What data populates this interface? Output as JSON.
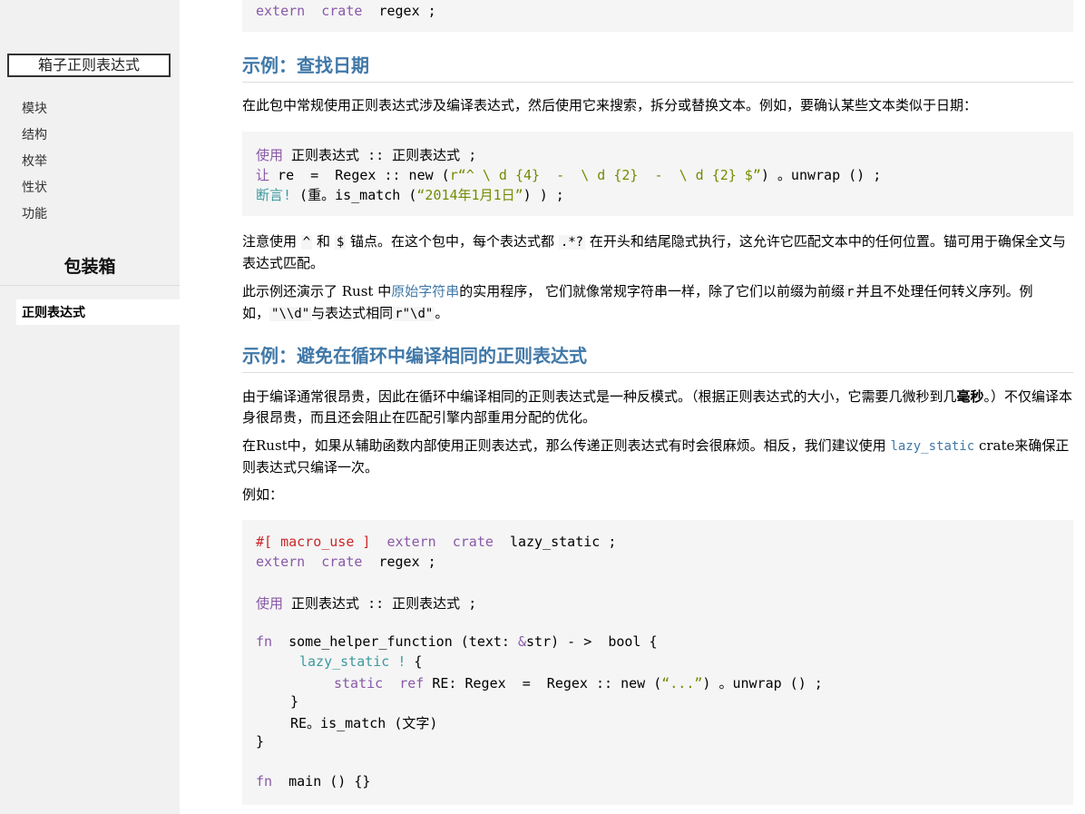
{
  "sidebar": {
    "search_value": "箱子正则表达式",
    "nav_items": [
      "模块",
      "结构",
      "枚举",
      "性状",
      "功能"
    ],
    "crate_title": "包装箱",
    "current_item": "正则表达式"
  },
  "top_code": {
    "line": [
      "extern",
      "crate",
      "regex ;"
    ]
  },
  "section1": {
    "heading": "示例：查找日期",
    "intro": "在此包中常规使用正则表达式涉及编译表达式，然后使用它来搜索，拆分或替换文本。例如，要确认某些文本类似于日期：",
    "code": {
      "l1": [
        "使用",
        " 正则表达式 :: 正则表达式 ;"
      ],
      "l2": [
        "让",
        " re  =  Regex :: new (",
        "r“^ \\ d {4}  -  \\ d {2}  -  \\ d {2} $”",
        ") 。unwrap () ;"
      ],
      "l3": [
        "断言!",
        " (重。is_match (",
        "“2014年1月1日”",
        ") ) ;"
      ]
    },
    "p2": {
      "t1": "注意使用",
      "c1": "^",
      "t2": "和",
      "c2": "$",
      "t3": "锚点。在这个包中，每个表达式都",
      "c3": ".*?",
      "t4": "在开头和结尾隐式执行，这允许它匹配文本中的任何位置。锚可用于确保全文与表达式匹配。"
    },
    "p3": {
      "t1": "此示例还演示了 Rust 中",
      "link": "原始字符串",
      "t2": "的实用程序， 它们就像常规字符串一样，除了它们以前缀为前缀",
      "c1": "r",
      "t3": "并且不处理任何转义序列。例如，",
      "c2": "\"\\\\d\"",
      "t4": "与表达式相同",
      "c3": "r\"\\d\"",
      "t5": "。"
    }
  },
  "section2": {
    "heading": "示例：避免在循环中编译相同的正则表达式",
    "p1": {
      "t1": "由于编译通常很昂贵，因此在循环中编译相同的正则表达式是一种反模式。（根据正则表达式的大小，它需要几微秒到几",
      "bold": "毫秒",
      "t2": "。）不仅编译本身很昂贵，而且还会阻止在匹配引擎内部重用分配的优化。"
    },
    "p2": {
      "t1": "在Rust中，如果从辅助函数内部使用正则表达式，那么传递正则表达式有时会很麻烦。相反，我们建议使用 ",
      "link": "lazy_static",
      "t2": " crate来确保正则表达式只编译一次。"
    },
    "p3": "例如：",
    "code": {
      "l1": [
        "#[ macro_use ]",
        "extern",
        "crate",
        "lazy_static ;"
      ],
      "l2": [
        "extern",
        "crate",
        "regex ;"
      ],
      "l3": [
        "使用",
        " 正则表达式 :: 正则表达式 ;"
      ],
      "l4": [
        "fn",
        "  some_helper_function (text: ",
        "&",
        "str) - >  bool {"
      ],
      "l5": [
        "lazy_static !",
        " {"
      ],
      "l6": [
        "static",
        "ref",
        " RE: Regex  =  Regex :: new (",
        "“...”",
        ") 。unwrap () ;"
      ],
      "l7": "}",
      "l8": "RE。is_match (文字)",
      "l9": "}",
      "l10": [
        "fn",
        "  main () {}"
      ]
    }
  },
  "colors": {
    "sidebar_bg": "#f1f1f1",
    "heading": "#4078a8",
    "keyword": "#8959a8",
    "macro": "#3e999f",
    "string": "#718c00",
    "attribute": "#c82829",
    "code_bg": "#f5f5f5"
  }
}
